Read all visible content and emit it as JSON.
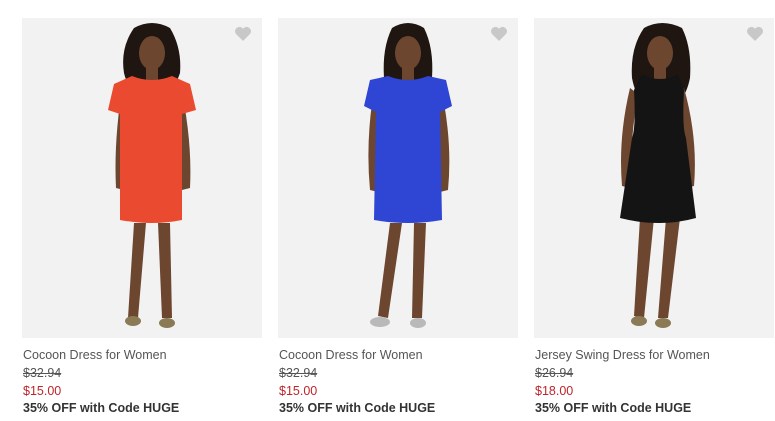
{
  "products": [
    {
      "name": "Cocoon Dress for Women",
      "original_price": "$32.94",
      "sale_price": "$15.00",
      "promo": "35% OFF with Code HUGE",
      "dress_color": "#ea4a2f",
      "shoe_color": "#8a7a55"
    },
    {
      "name": "Cocoon Dress for Women",
      "original_price": "$32.94",
      "sale_price": "$15.00",
      "promo": "35% OFF with Code HUGE",
      "dress_color": "#2f45d3",
      "shoe_color": "#b9b9b9"
    },
    {
      "name": "Jersey Swing Dress for Women",
      "original_price": "$26.94",
      "sale_price": "$18.00",
      "promo": "35% OFF with Code HUGE",
      "dress_color": "#141414",
      "shoe_color": "#8a7a55"
    }
  ],
  "colors": {
    "photo_background": "#f2f2f2",
    "heart": "#c8c8c8",
    "sale_price": "#c0242b",
    "text": "#555555"
  },
  "icons": {
    "favorite": "heart-icon"
  }
}
